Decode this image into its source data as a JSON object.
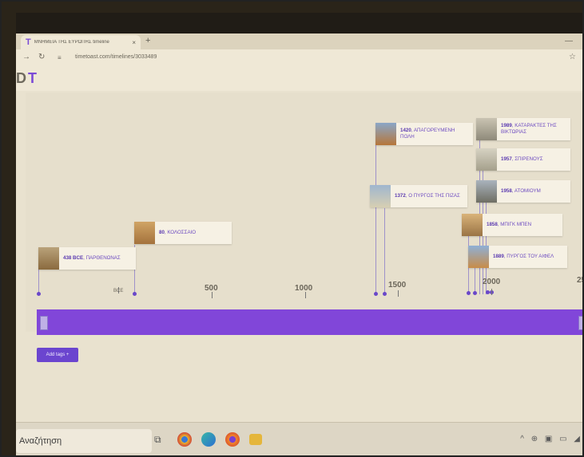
{
  "browser": {
    "tab_title": "ΜΝΗΜΕΙΑ ΤΗΣ ΕΥΡΩΠΗΣ timeline",
    "tab_close": "×",
    "new_tab": "+",
    "url": "timetoast.com/timelines/3033489",
    "minimize": "—"
  },
  "app": {
    "logo_left": "D",
    "logo_right": "T"
  },
  "timeline": {
    "events": [
      {
        "year": "438 BCE",
        "title": "ΠΑΡΘΕΝΩΝΑΣ"
      },
      {
        "year": "80",
        "title": "ΚΟΛΟΣΣΑΙΟ"
      },
      {
        "year": "1420",
        "title": "ΑΠΑΓΟΡΕΥΜΕΝΗ ΠΟΛΗ"
      },
      {
        "year": "1372",
        "title": "Ο ΠΥΡΓΟΣ ΤΗΣ ΠΙΖΑΣ"
      },
      {
        "year": "1989",
        "title": "ΚΑΤΑΡΑΚΤΕΣ ΤΗΣ ΒΙΚΤΩΡΙΑΣ"
      },
      {
        "year": "1957",
        "title": "ΣΠΙΡΕΝΟΥΣ"
      },
      {
        "year": "1958",
        "title": "ΑΤΟΜΙΟΥΜ"
      },
      {
        "year": "1858",
        "title": "ΜΠΙΓΚ ΜΠΕΝ"
      },
      {
        "year": "1889",
        "title": "ΠΥΡΓΟΣ ΤΟΥ ΑΙΦΕΛ"
      }
    ],
    "axis": {
      "bce_label": "BCE",
      "ticks": [
        "500",
        "1000",
        "1500",
        "2000",
        "25"
      ]
    },
    "add_tags_label": "Add tags +"
  },
  "taskbar": {
    "search_placeholder": "Αναζήτηση",
    "tray": "^ ⊕ ▣ ▭ ◢"
  },
  "colors": {
    "accent": "#7b4ad6",
    "bar": "#8146d9",
    "card_text": "#6d4bc1"
  }
}
